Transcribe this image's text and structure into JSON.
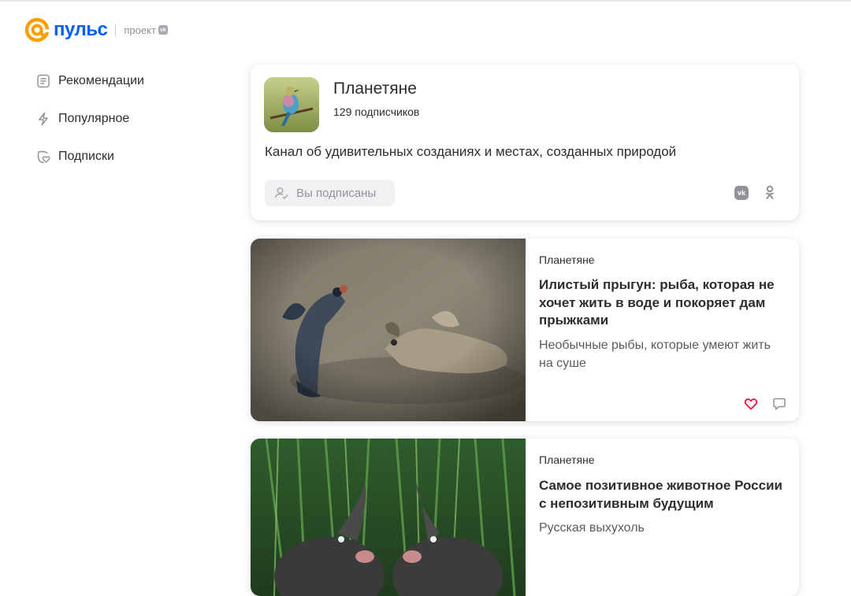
{
  "header": {
    "logo_text": "пульс",
    "project_label": "проект",
    "project_badge": "vk",
    "brand_color": "#005ff9",
    "logo_accent": "#ff9e00"
  },
  "nav": {
    "items": [
      {
        "label": "Рекомендации",
        "icon": "list-icon"
      },
      {
        "label": "Популярное",
        "icon": "lightning-icon"
      },
      {
        "label": "Подписки",
        "icon": "heart-subscriptions-icon"
      }
    ]
  },
  "channel": {
    "title": "Планетяне",
    "subscribers": "129 подписчиков",
    "description": "Канал об удивительных созданиях и местах, созданных природой",
    "subscribe_button": "Вы подписаны",
    "share": {
      "vk": "vk",
      "ok": "ok-icon"
    }
  },
  "articles": [
    {
      "source": "Планетяне",
      "title": "Илистый прыгун: рыба, которая не хочет жить в воде и покоряет дам прыжками",
      "subtitle": "Необычные рыбы, которые умеют жить на суше",
      "liked": true,
      "like_color": "#ed0a34"
    },
    {
      "source": "Планетяне",
      "title": "Самое позитивное животное России с непозитивным будущим",
      "subtitle": "Русская выхухоль"
    }
  ]
}
